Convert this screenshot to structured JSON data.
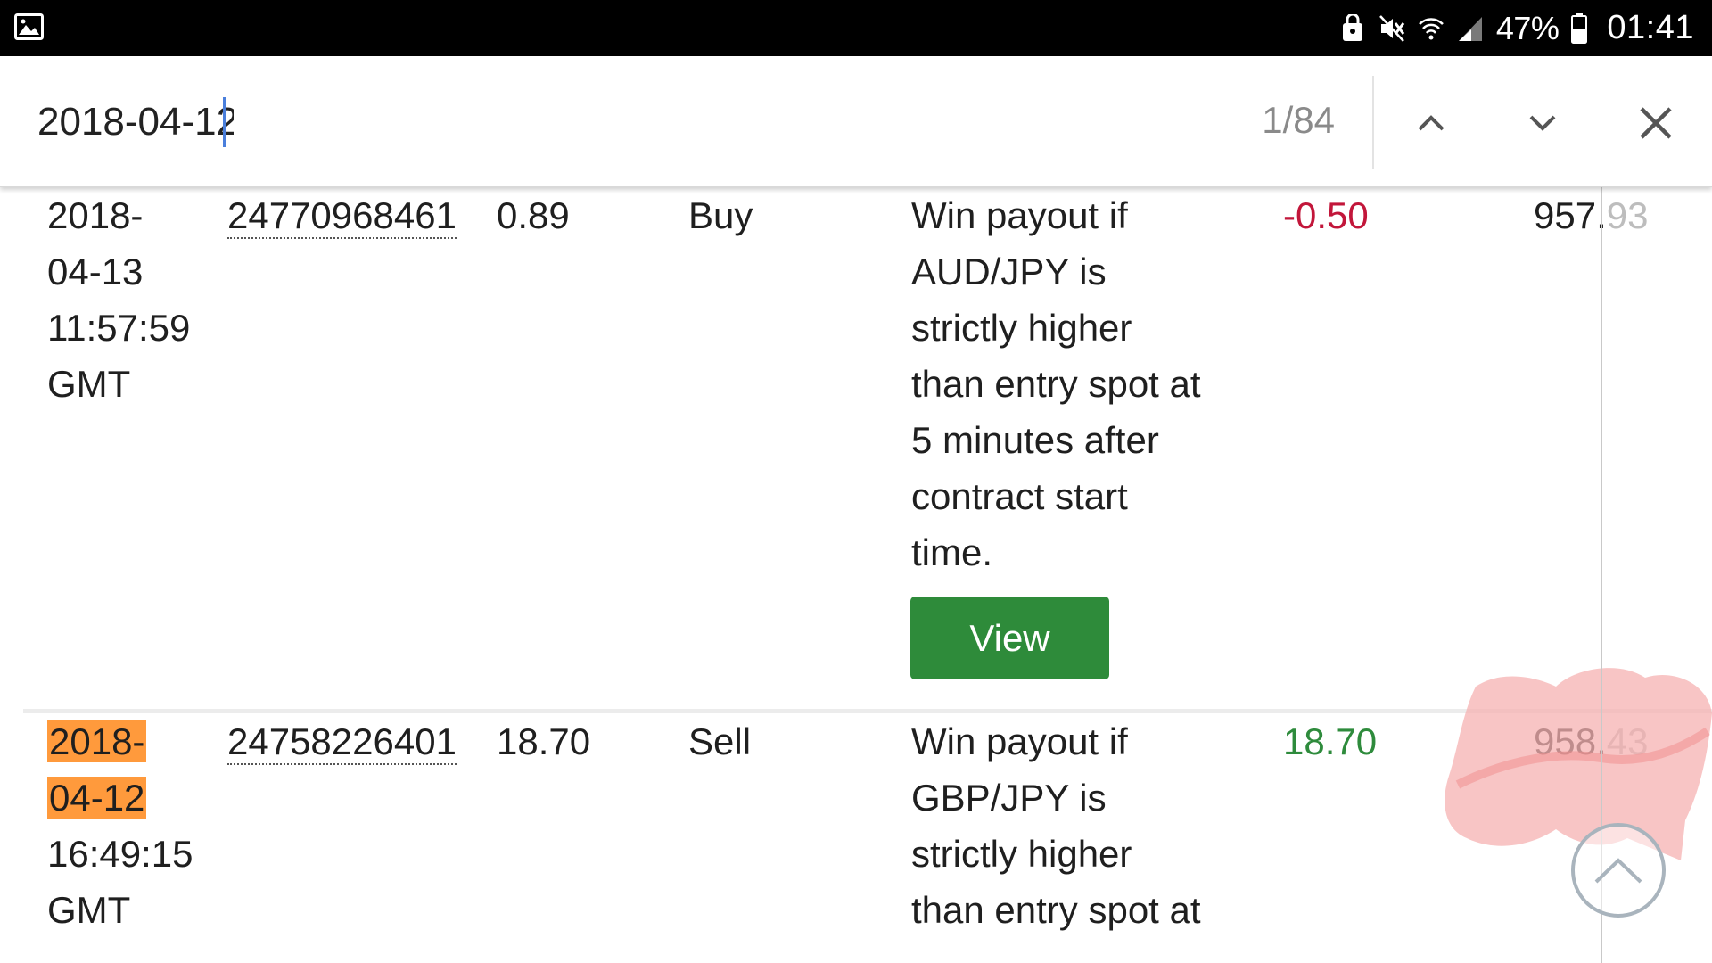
{
  "status_bar": {
    "battery_percent": "47%",
    "time": "01:41",
    "icons": [
      "gallery-icon",
      "vpn-key-icon",
      "mute-icon",
      "wifi-icon",
      "cell-signal-icon",
      "battery-icon"
    ]
  },
  "find_bar": {
    "query": "2018-04-12",
    "match_count": "1/84",
    "icons": [
      "chevron-up-icon",
      "chevron-down-icon",
      "close-icon"
    ]
  },
  "rows": [
    {
      "date_lines": [
        "2018-",
        "04-13",
        "11:57:59",
        "GMT"
      ],
      "ref_id": "24770968461",
      "price": "0.89",
      "type": "Buy",
      "description_lines": [
        "Win payout if",
        "AUD/JPY is",
        "strictly higher",
        "than entry spot at",
        "5 minutes after",
        "contract start",
        "time."
      ],
      "amount": "-0.50",
      "balance_visible": "957.",
      "balance_faded": "93",
      "view_label": "View"
    },
    {
      "date_lines": [
        "2018-",
        "04-12",
        "16:49:15",
        "GMT"
      ],
      "ref_id": "24758226401",
      "price": "18.70",
      "type": "Sell",
      "description_lines": [
        "Win payout if",
        "GBP/JPY is",
        "strictly higher",
        "than entry spot at"
      ],
      "amount": "18.70",
      "balance_visible": "958.",
      "balance_faded": "43"
    }
  ],
  "colors": {
    "negative": "#c2163a",
    "positive": "#2e8b3c",
    "view_button": "#2e8b3a",
    "find_highlight": "#ff9a3c",
    "caret": "#4a7fdc",
    "scribble": "#f4a6a6"
  }
}
